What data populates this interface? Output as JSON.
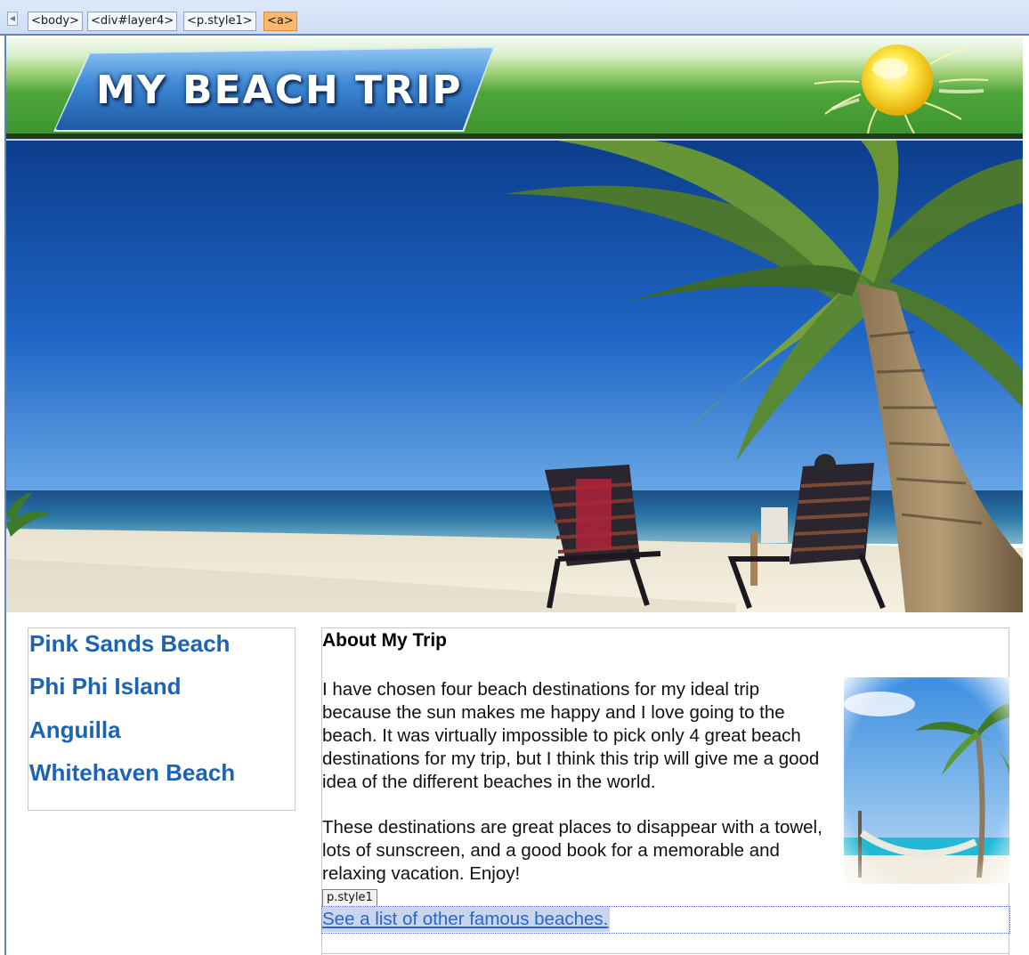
{
  "tag_selector": {
    "tags": [
      "<body>",
      "<div#layer4>",
      "<p.style1>",
      "<a>"
    ],
    "active_index": 3
  },
  "header": {
    "logo_text": "MY BEACH TRIP"
  },
  "nav": {
    "links": [
      "Pink Sands Beach",
      "Phi Phi Island",
      "Anguilla",
      "Whitehaven Beach"
    ]
  },
  "content": {
    "title": "About My Trip",
    "paragraph_1": "I have chosen four beach destinations for my ideal trip because the sun makes me happy and I love going to the beach. It was virtually impossible to pick only 4 great beach destinations for my trip, but I think this trip will give me a good idea of the different beaches in the world.",
    "paragraph_2": "These destinations are great places to disappear with a towel, lots of sunscreen, and a good book for a memorable and relaxing vacation. Enjoy!",
    "style_tag": "p.style1",
    "link_text": "See a list of other famous beaches."
  },
  "colors": {
    "link": "#1d63b3",
    "header_green": "#3d9431",
    "tag_active": "#fbb86a"
  }
}
